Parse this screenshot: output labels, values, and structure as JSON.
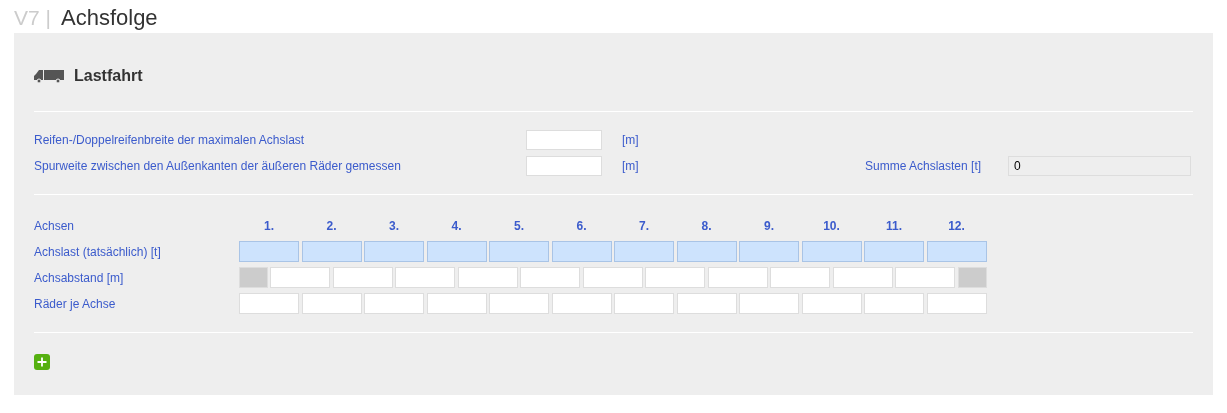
{
  "header": {
    "prefix": "V7 |",
    "title": "Achsfolge"
  },
  "section": {
    "title": "Lastfahrt"
  },
  "fields": [
    {
      "label": "Reifen-/Doppelreifenbreite der maximalen Achslast",
      "unit": "[m]"
    },
    {
      "label": "Spurweite zwischen den Außenkanten der äußeren Räder gemessen",
      "unit": "[m]"
    }
  ],
  "sum": {
    "label": "Summe Achslasten [t]",
    "value": "0"
  },
  "axles": {
    "label": "Achsen",
    "headers": [
      "1.",
      "2.",
      "3.",
      "4.",
      "5.",
      "6.",
      "7.",
      "8.",
      "9.",
      "10.",
      "11.",
      "12."
    ],
    "rows": [
      {
        "label": "Achslast (tatsächlich) [t]",
        "kind": "load"
      },
      {
        "label": "Achsabstand [m]",
        "kind": "spacing"
      },
      {
        "label": "Räder je Achse",
        "kind": "plain"
      }
    ]
  }
}
